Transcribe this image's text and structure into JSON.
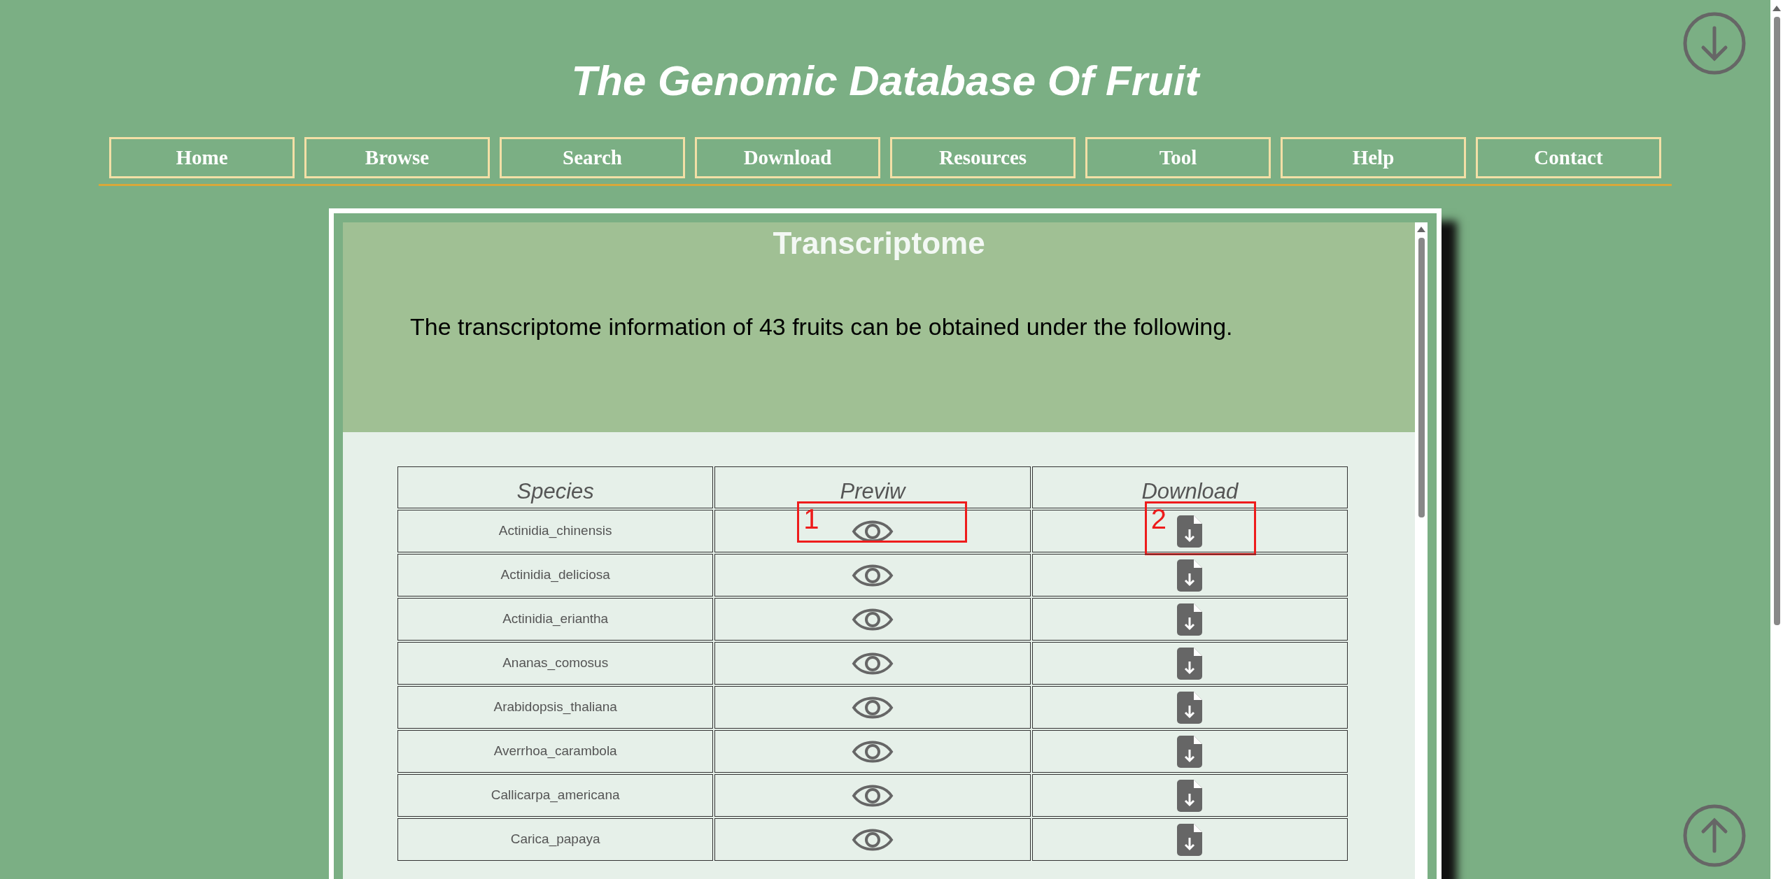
{
  "site_title": "The Genomic Database Of Fruit",
  "nav": [
    {
      "label": "Home"
    },
    {
      "label": "Browse"
    },
    {
      "label": "Search"
    },
    {
      "label": "Download"
    },
    {
      "label": "Resources"
    },
    {
      "label": "Tool"
    },
    {
      "label": "Help"
    },
    {
      "label": "Contact"
    }
  ],
  "panel": {
    "title": "Transcriptome",
    "description": "The transcriptome information of 43 fruits can be obtained under the following."
  },
  "table": {
    "columns": [
      "Species",
      "Previw",
      "Download"
    ],
    "rows": [
      {
        "species": "Actinidia_chinensis",
        "preview_annotation": "1",
        "download_annotation": "2"
      },
      {
        "species": "Actinidia_deliciosa"
      },
      {
        "species": "Actinidia_eriantha"
      },
      {
        "species": "Ananas_comosus"
      },
      {
        "species": "Arabidopsis_thaliana"
      },
      {
        "species": "Averrhoa_carambola"
      },
      {
        "species": "Callicarpa_americana"
      },
      {
        "species": "Carica_papaya"
      }
    ]
  }
}
